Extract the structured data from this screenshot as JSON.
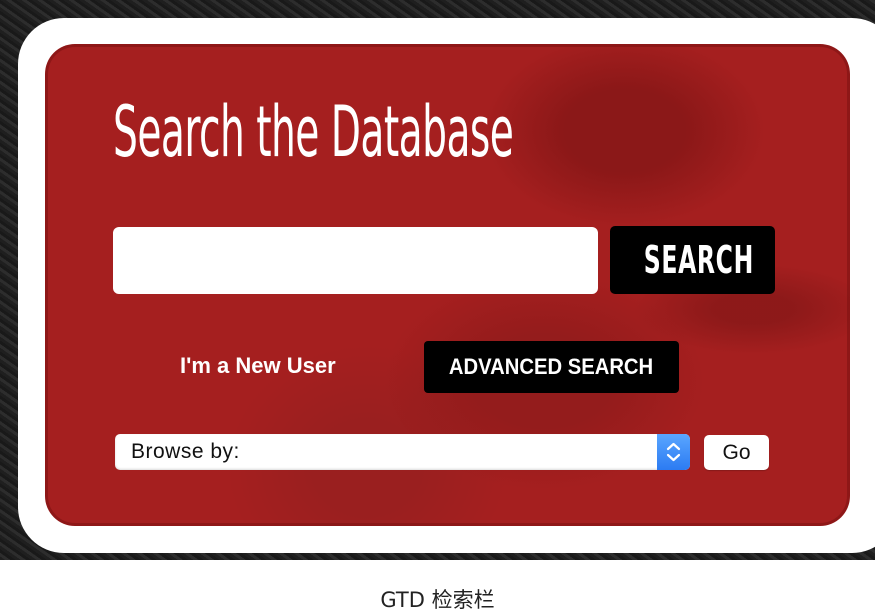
{
  "title": "Search the Database",
  "search": {
    "value": "",
    "button_label": "SEARCH"
  },
  "links": {
    "new_user": "I'm a New User"
  },
  "advanced_search": {
    "label": "ADVANCED SEARCH"
  },
  "browse": {
    "selected": "Browse by:",
    "go_label": "Go"
  },
  "caption": "GTD 检索栏",
  "colors": {
    "panel_red": "#a51f1f",
    "button_black": "#000000",
    "stepper_blue": "#2c7bf2"
  }
}
